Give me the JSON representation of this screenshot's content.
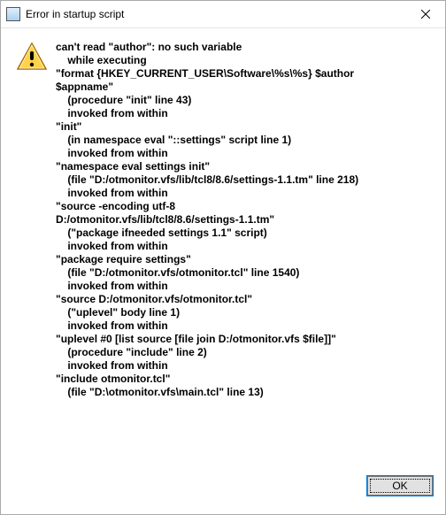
{
  "title": "Error in startup script",
  "message": "can't read \"author\": no such variable\n    while executing\n\"format {HKEY_CURRENT_USER\\Software\\%s\\%s} $author\n$appname\"\n    (procedure \"init\" line 43)\n    invoked from within\n\"init\"\n    (in namespace eval \"::settings\" script line 1)\n    invoked from within\n\"namespace eval settings init\"\n    (file \"D:/otmonitor.vfs/lib/tcl8/8.6/settings-1.1.tm\" line 218)\n    invoked from within\n\"source -encoding utf-8\nD:/otmonitor.vfs/lib/tcl8/8.6/settings-1.1.tm\"\n    (\"package ifneeded settings 1.1\" script)\n    invoked from within\n\"package require settings\"\n    (file \"D:/otmonitor.vfs/otmonitor.tcl\" line 1540)\n    invoked from within\n\"source D:/otmonitor.vfs/otmonitor.tcl\"\n    (\"uplevel\" body line 1)\n    invoked from within\n\"uplevel #0 [list source [file join D:/otmonitor.vfs $file]]\"\n    (procedure \"include\" line 2)\n    invoked from within\n\"include otmonitor.tcl\"\n    (file \"D:\\otmonitor.vfs\\main.tcl\" line 13)",
  "buttons": {
    "ok": "OK"
  }
}
